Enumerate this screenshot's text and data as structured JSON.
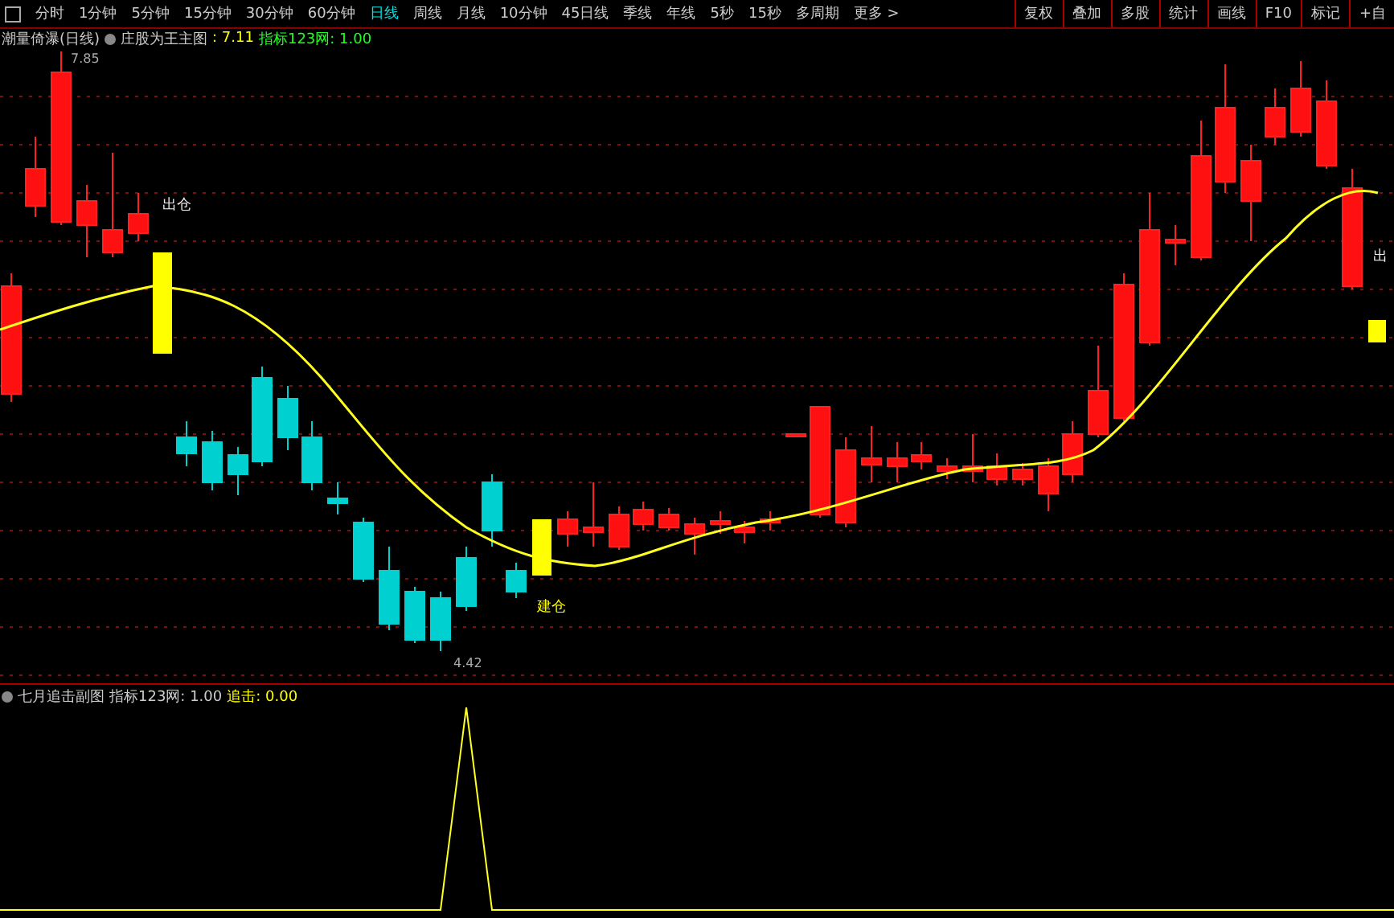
{
  "period_tabs": [
    {
      "label": "分时",
      "selected": false
    },
    {
      "label": "1分钟",
      "selected": false
    },
    {
      "label": "5分钟",
      "selected": false
    },
    {
      "label": "15分钟",
      "selected": false
    },
    {
      "label": "30分钟",
      "selected": false
    },
    {
      "label": "60分钟",
      "selected": false
    },
    {
      "label": "日线",
      "selected": true
    },
    {
      "label": "周线",
      "selected": false
    },
    {
      "label": "月线",
      "selected": false
    },
    {
      "label": "10分钟",
      "selected": false
    },
    {
      "label": "45日线",
      "selected": false
    },
    {
      "label": "季线",
      "selected": false
    },
    {
      "label": "年线",
      "selected": false
    },
    {
      "label": "5秒",
      "selected": false
    },
    {
      "label": "15秒",
      "selected": false
    },
    {
      "label": "多周期",
      "selected": false
    },
    {
      "label": "更多 >",
      "selected": false
    }
  ],
  "tool_buttons": [
    "复权",
    "叠加",
    "多股",
    "统计",
    "画线",
    "F10",
    "标记",
    "+自"
  ],
  "main_legend": {
    "title": "潮量倚瀑(日线)",
    "indicator": "庄股为王主图",
    "value": ": 7.11",
    "source": "指标123网: 1.00"
  },
  "main_chart": {
    "high_label": "7.85",
    "low_label": "4.42",
    "signals": [
      "出仓",
      "建仓",
      "出"
    ]
  },
  "sub_legend": {
    "title": "七月追击副图",
    "source": "指标123网: 1.00",
    "value": "追击: 0.00"
  }
}
